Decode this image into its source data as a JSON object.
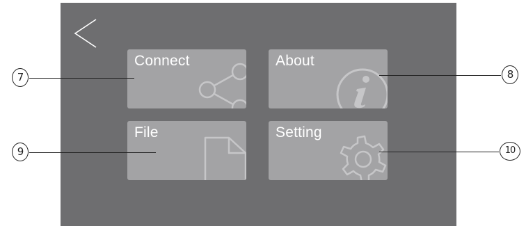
{
  "tiles": {
    "connect": {
      "label": "Connect"
    },
    "about": {
      "label": "About"
    },
    "file": {
      "label": "File"
    },
    "setting": {
      "label": "Setting"
    }
  },
  "callouts": {
    "connect": "7",
    "about": "8",
    "file": "9",
    "setting": "10"
  },
  "icons": {
    "back": "chevron-left-icon",
    "connect": "share-icon",
    "about": "info-icon",
    "file": "document-icon",
    "setting": "gear-icon"
  }
}
